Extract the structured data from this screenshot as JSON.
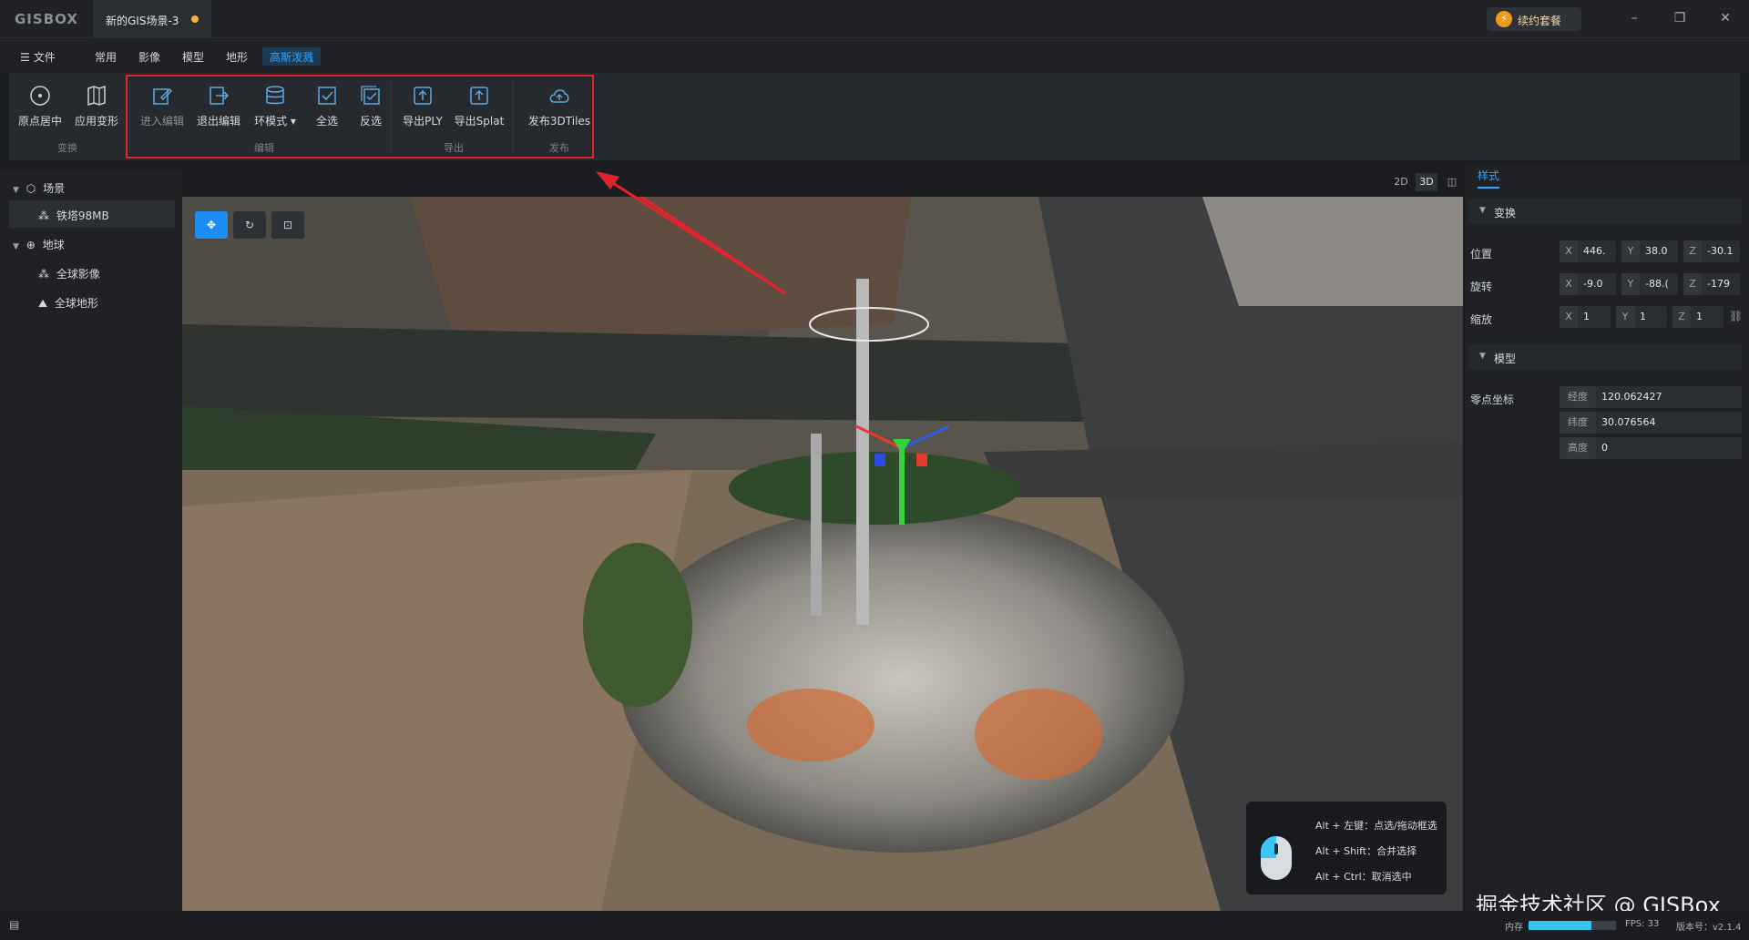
{
  "app": {
    "logo": "GISBOX",
    "doc_tab": "新的GIS场景-3",
    "renew_label": "续约套餐"
  },
  "menu": {
    "file": "文件",
    "items": [
      "常用",
      "影像",
      "模型",
      "地形",
      "高斯泼溅"
    ],
    "active_index": 4
  },
  "ribbon": {
    "groups": {
      "transform": "变换",
      "edit": "编辑",
      "export": "导出",
      "publish": "发布"
    },
    "buttons": {
      "origin_center": "原点居中",
      "apply_transform": "应用变形",
      "enter_edit": "进入编辑",
      "exit_edit": "退出编辑",
      "ring_mode": "环模式 ▾",
      "select_all": "全选",
      "invert": "反选",
      "export_ply": "导出PLY",
      "export_splat": "导出Splat",
      "publish_3dtiles": "发布3DTiles"
    }
  },
  "scene_tree": {
    "scene_label": "场景",
    "scene_item": "铁塔98MB",
    "earth_label": "地球",
    "earth_items": [
      "全球影像",
      "全球地形"
    ]
  },
  "view_modes": [
    "2D",
    "3D",
    "◫"
  ],
  "view_mode_active": "3D",
  "properties": {
    "tab": "样式",
    "transform_section": "变换",
    "position_label": "位置",
    "position": {
      "x": "446.",
      "y": "38.0",
      "z": "-30.1"
    },
    "rotation_label": "旋转",
    "rotation": {
      "x": "-9.0",
      "y": "-88.(",
      "z": "-179"
    },
    "scale_label": "缩放",
    "scale": {
      "x": "1",
      "y": "1",
      "z": "1"
    },
    "model_section": "模型",
    "origin_label": "零点坐标",
    "longitude_label": "经度",
    "longitude": "120.062427",
    "latitude_label": "纬度",
    "latitude": "30.076564",
    "height_label": "高度",
    "height": "0"
  },
  "hint": {
    "line1": "Alt + 左键：点选/拖动框选",
    "line2": "Alt + Shift：合并选择",
    "line3": "Alt + Ctrl：取消选中"
  },
  "status": {
    "memory_label": "内存",
    "memory_fraction": 0.72,
    "fps": "FPS: 33",
    "version": "版本号：v2.1.4"
  },
  "watermark": "掘金技术社区 @ GISBox",
  "colors": {
    "accent": "#31a5ff",
    "highlight": "#e3242b",
    "active_tool": "#1e8cf5"
  }
}
